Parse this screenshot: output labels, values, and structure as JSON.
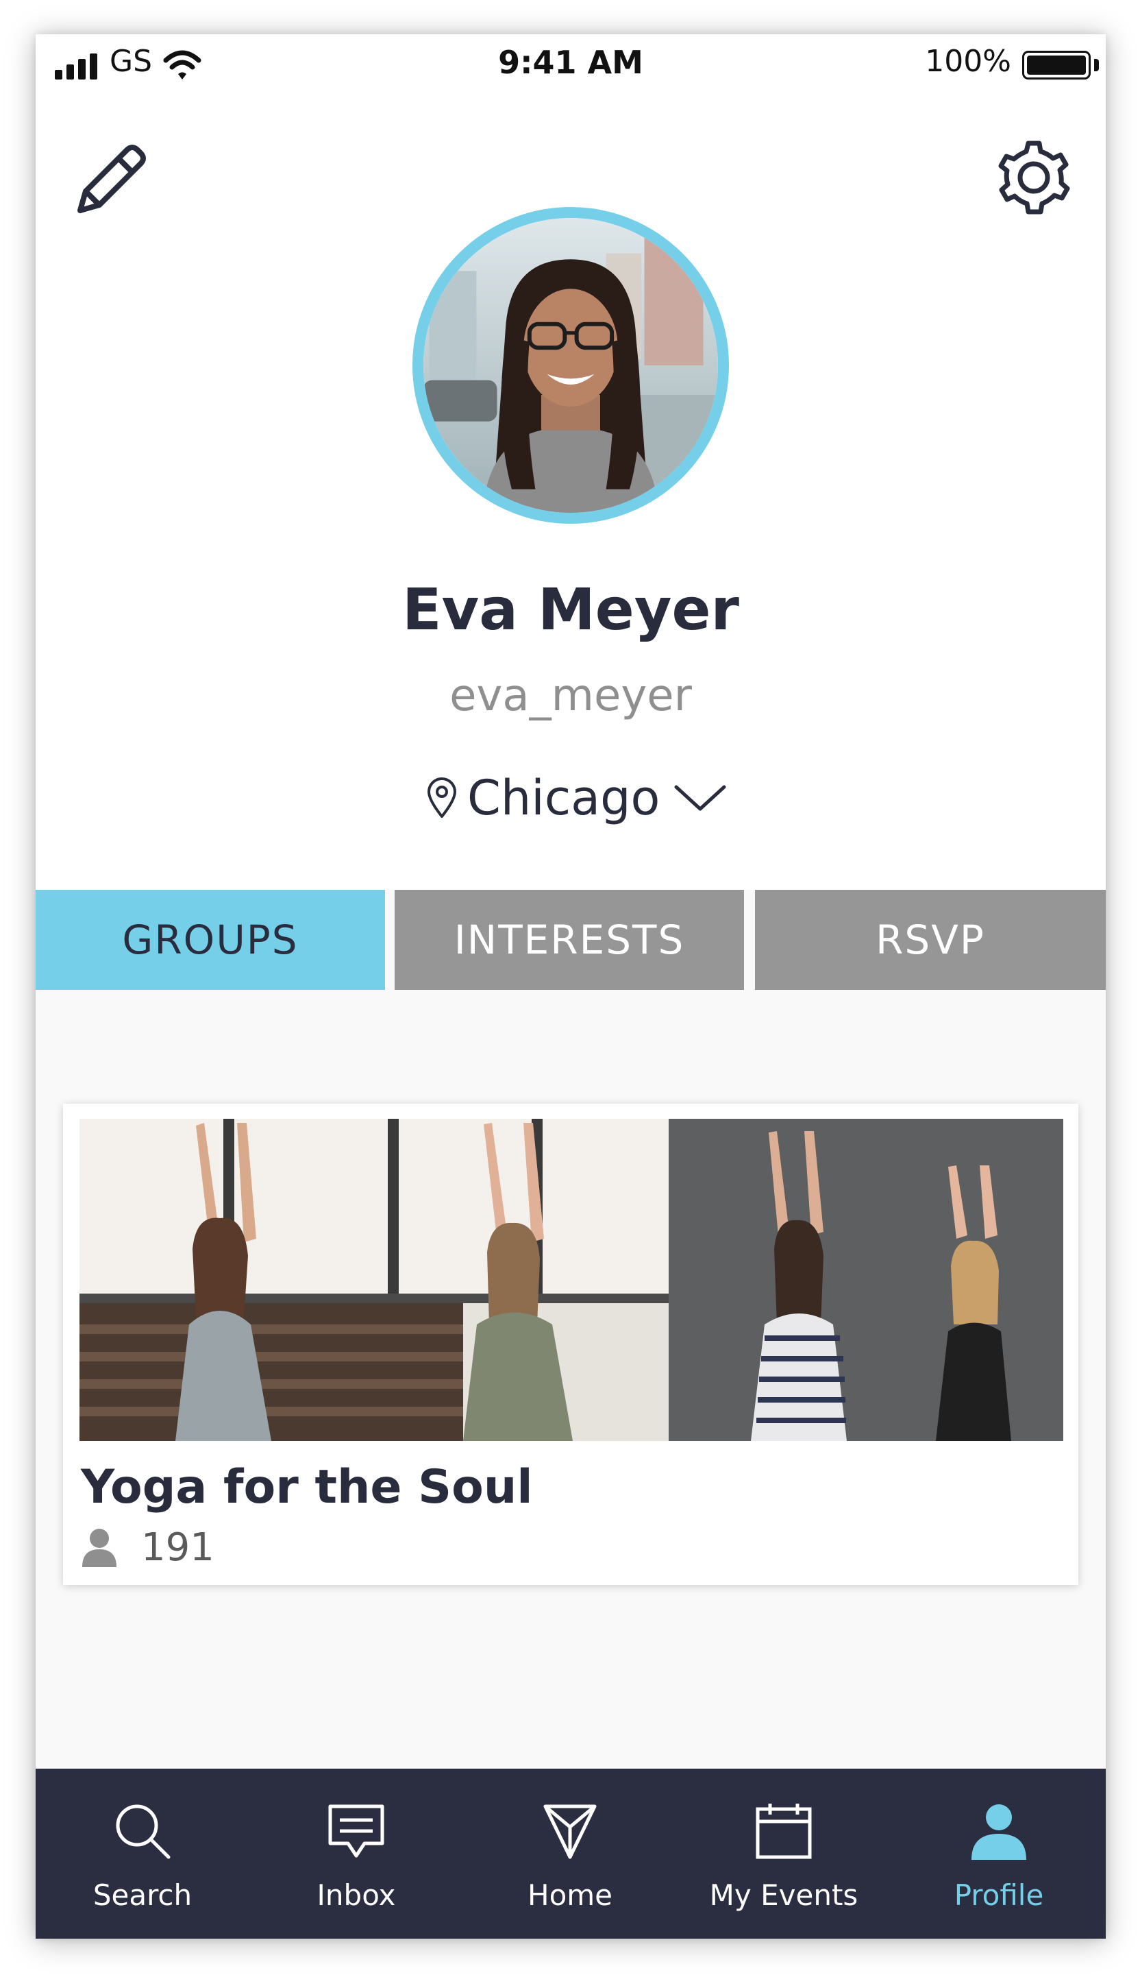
{
  "status_bar": {
    "carrier": "GS",
    "time": "9:41 AM",
    "battery_percent": "100%",
    "battery_level": 1.0,
    "signal_bars": 4
  },
  "toolbar": {
    "edit_icon": "pencil-icon",
    "settings_icon": "gear-icon"
  },
  "profile": {
    "name": "Eva Meyer",
    "username": "eva_meyer",
    "location": "Chicago"
  },
  "tabs": [
    {
      "label": "GROUPS",
      "active": true
    },
    {
      "label": "INTERESTS",
      "active": false
    },
    {
      "label": "RSVP",
      "active": false
    }
  ],
  "groups": [
    {
      "title": "Yoga for the Soul",
      "members": "191"
    }
  ],
  "bottom_nav": [
    {
      "label": "Search",
      "icon": "search-icon",
      "active": false
    },
    {
      "label": "Inbox",
      "icon": "chat-icon",
      "active": false
    },
    {
      "label": "Home",
      "icon": "send-icon",
      "active": false
    },
    {
      "label": "My Events",
      "icon": "calendar-icon",
      "active": false
    },
    {
      "label": "Profile",
      "icon": "person-icon",
      "active": true
    }
  ],
  "colors": {
    "accent": "#75cfe8",
    "dark": "#292c3d",
    "nav_bg": "#2b2e40",
    "tab_inactive": "#969696",
    "muted_text": "#8f8f8f"
  }
}
